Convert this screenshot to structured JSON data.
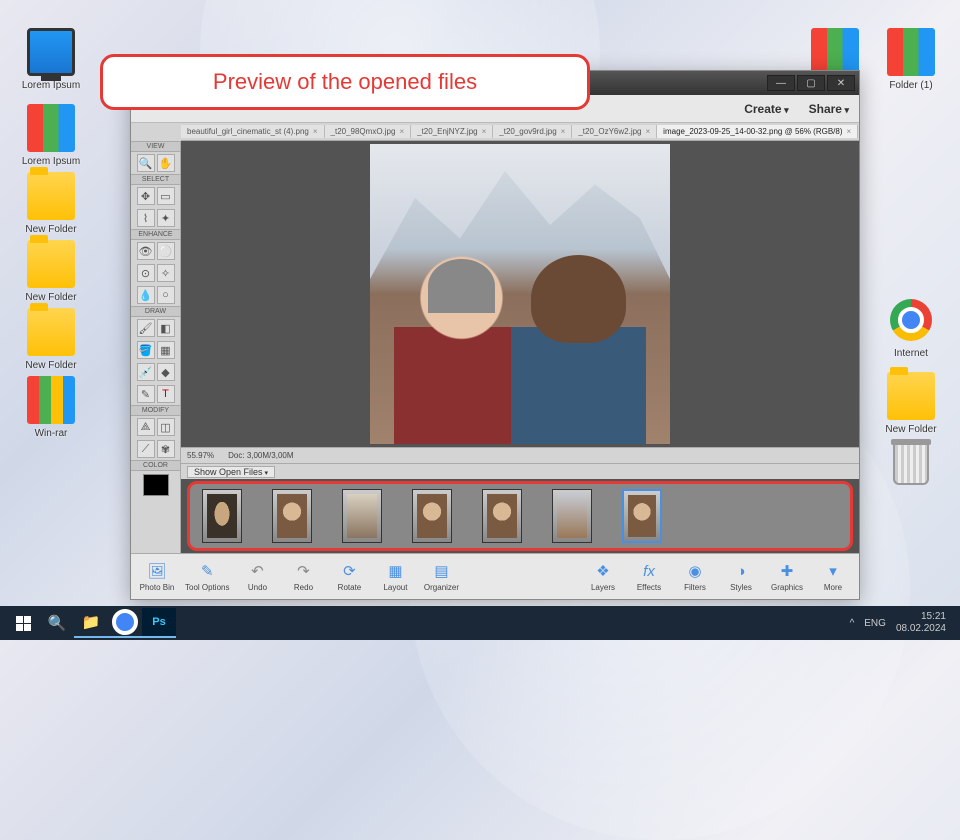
{
  "callout_text": "Preview of the opened files",
  "desktop": {
    "left": [
      {
        "label": "Lorem Ipsum",
        "type": "pc"
      },
      {
        "label": "Lorem Ipsum",
        "type": "binder"
      },
      {
        "label": "New Folder",
        "type": "folder"
      },
      {
        "label": "New Folder",
        "type": "folder"
      },
      {
        "label": "New Folder",
        "type": "folder"
      },
      {
        "label": "Win-rar",
        "type": "winrar"
      }
    ],
    "right": [
      {
        "label": "",
        "type": "binder"
      },
      {
        "label": "Folder (1)",
        "type": "binder"
      },
      {
        "label": "Internet",
        "type": "chrome"
      },
      {
        "label": "New Folder",
        "type": "folder"
      },
      {
        "label": "",
        "type": "trash"
      }
    ]
  },
  "app": {
    "menu": {
      "create": "Create",
      "share": "Share"
    },
    "tabs": [
      "beautiful_girl_cinematic_st (4).png",
      "_t20_98QmxO.jpg",
      "_t20_EnjNYZ.jpg",
      "_t20_gov9rd.jpg",
      "_t20_OzY6w2.jpg",
      "image_2023-09-25_14-00-32.png @ 56% (RGB/8)"
    ],
    "active_tab": 5,
    "toolbox": {
      "view": "VIEW",
      "select": "SELECT",
      "enhance": "ENHANCE",
      "draw": "DRAW",
      "modify": "MODIFY",
      "color": "COLOR"
    },
    "status": {
      "zoom": "55.97%",
      "doc": "Doc:  3,00M/3,00M"
    },
    "showbar": "Show Open Files",
    "bottom": {
      "photobin": "Photo Bin",
      "tooloptions": "Tool Options",
      "undo": "Undo",
      "redo": "Redo",
      "rotate": "Rotate",
      "layout": "Layout",
      "organizer": "Organizer",
      "layers": "Layers",
      "effects": "Effects",
      "filters": "Filters",
      "styles": "Styles",
      "graphics": "Graphics",
      "more": "More"
    }
  },
  "taskbar": {
    "lang": "ENG",
    "time": "15:21",
    "date": "08.02.2024"
  }
}
